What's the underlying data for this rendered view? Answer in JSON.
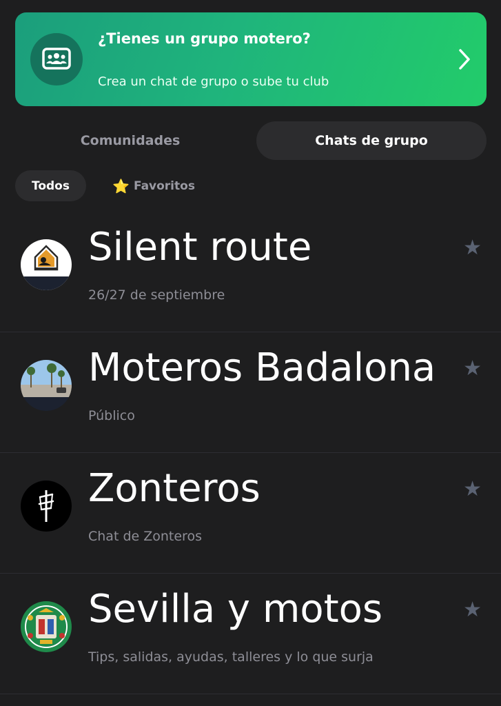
{
  "banner": {
    "title": "¿Tienes un grupo motero?",
    "subtitle": "Crea un chat de grupo o sube tu club",
    "icon": "group-people-icon",
    "accent_from": "#1b9e7c",
    "accent_to": "#22cc6a"
  },
  "tabs": {
    "communities": "Comunidades",
    "chats": "Chats de grupo",
    "active": "chats"
  },
  "filters": {
    "all": "Todos",
    "favorites_icon": "⭐",
    "favorites": "Favoritos",
    "active": "all"
  },
  "chats": [
    {
      "name": "Silent route",
      "subtitle": "26/27 de septiembre",
      "avatar": "silent-route-logo",
      "favorite": false
    },
    {
      "name": "Moteros Badalona",
      "subtitle": "Público",
      "avatar": "beach-photo",
      "favorite": false
    },
    {
      "name": "Zonteros",
      "subtitle": "Chat de Zonteros",
      "avatar": "zonteros-logo",
      "favorite": false
    },
    {
      "name": "Sevilla y motos",
      "subtitle": "Tips, salidas, ayudas, talleres y lo que surja",
      "avatar": "sevilla-crest",
      "favorite": false
    }
  ],
  "colors": {
    "background": "#1e1e1f",
    "active_pill": "#2c2c2e",
    "muted_text": "#8e8e96",
    "star_inactive": "#5a6272",
    "star_gold": "#f7c21b"
  }
}
